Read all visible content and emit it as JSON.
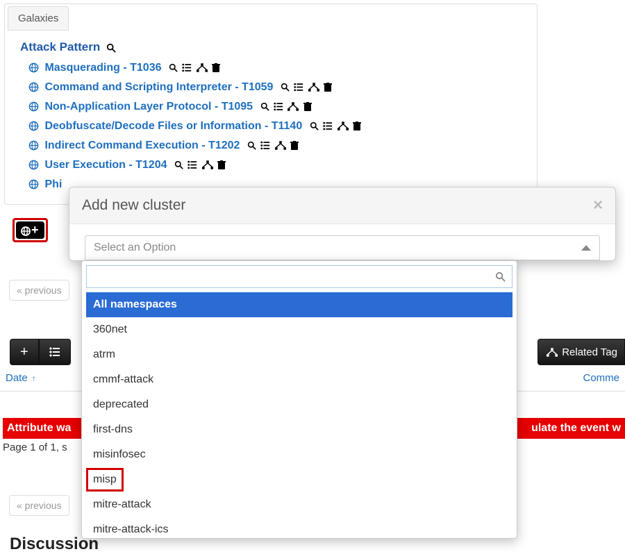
{
  "galaxies": {
    "tab_label": "Galaxies",
    "cluster_title": "Attack Pattern",
    "items": [
      {
        "label": "Masquerading - T1036"
      },
      {
        "label": "Command and Scripting Interpreter - T1059"
      },
      {
        "label": "Non-Application Layer Protocol - T1095"
      },
      {
        "label": "Deobfuscate/Decode Files or Information - T1140"
      },
      {
        "label": "Indirect Command Execution - T1202"
      },
      {
        "label": "User Execution - T1204"
      },
      {
        "label": "Phi"
      }
    ]
  },
  "modal": {
    "title": "Add new cluster",
    "select_placeholder": "Select an Option",
    "search_value": "",
    "options": [
      "All namespaces",
      "360net",
      "atrm",
      "cmmf-attack",
      "deprecated",
      "first-dns",
      "misinfosec",
      "misp",
      "mitre-attack",
      "mitre-attack-ics"
    ],
    "selected_index": 0,
    "highlighted_option": "misp"
  },
  "pager": {
    "previous_label": "« previous"
  },
  "toolbar": {
    "related_tags_label": "Related Tag"
  },
  "table": {
    "date_header": "Date",
    "comment_header": "Comme"
  },
  "warning": {
    "left_fragment": "Attribute wa",
    "right_fragment": "ulate the event w"
  },
  "page_info": "Page 1 of 1, s",
  "discussion_heading": "Discussion"
}
